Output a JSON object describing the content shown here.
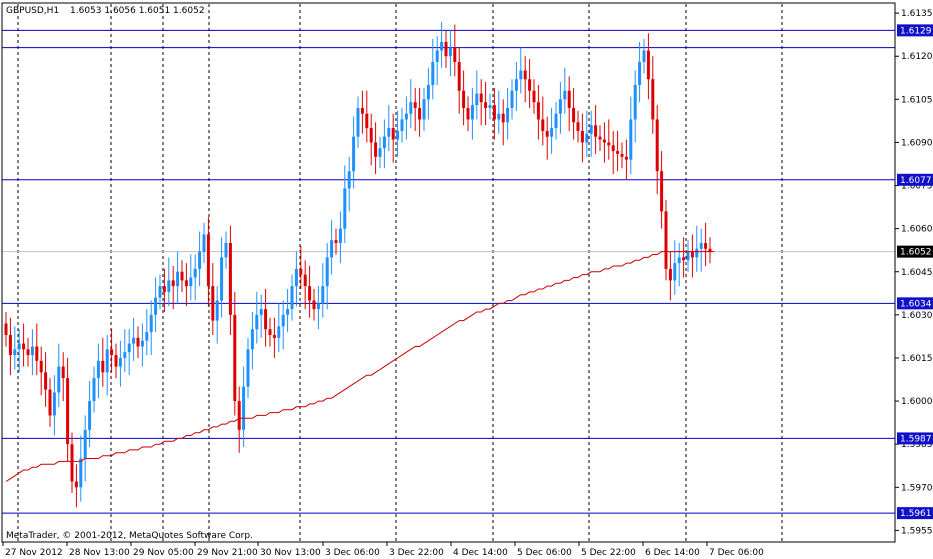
{
  "header": {
    "symbol": "GBPUSD,H1",
    "ohlc": "1.6053 1.6056 1.6051 1.6052"
  },
  "copyright": "MetaTrader, © 2001-2012, MetaQuotes Software Corp.",
  "colors": {
    "up": "#1e90ff",
    "down": "#dd0000",
    "ma": "#cc0000",
    "hline": "#0000cc",
    "grid": "#000000",
    "tag": "#1010c8",
    "current": "#000000"
  },
  "chart_data": {
    "type": "candlestick",
    "y_range": [
      1.595,
      1.614
    ],
    "y_ticks": [
      "1.6135",
      "1.6120",
      "1.6105",
      "1.6090",
      "1.6075",
      "1.6060",
      "1.6045",
      "1.6030",
      "1.6015",
      "1.6000",
      "1.5985",
      "1.5970",
      "1.5955"
    ],
    "x_ticks": [
      "27 Nov 2012",
      "28 Nov 13:00",
      "29 Nov 05:00",
      "29 Nov 21:00",
      "30 Nov 13:00",
      "3 Dec 06:00",
      "3 Dec 22:00",
      "4 Dec 14:00",
      "5 Dec 06:00",
      "5 Dec 22:00",
      "6 Dec 14:00",
      "7 Dec 06:00"
    ],
    "horizontal_lines": [
      {
        "label": "1.6129",
        "value": 1.6129
      },
      {
        "label": "1.6077",
        "value": 1.6077
      },
      {
        "label": "1.6034",
        "value": 1.6034
      },
      {
        "label": "1.5987",
        "value": 1.5987
      },
      {
        "label": "1.5961",
        "value": 1.5961
      }
    ],
    "current_price": {
      "label": "1.6052",
      "value": 1.6052
    },
    "series": [
      {
        "kind": "close",
        "values": [
          1.6023,
          1.6016,
          1.6018,
          1.602,
          1.6018,
          1.6016,
          1.6019,
          1.6014,
          1.601,
          1.6004,
          1.5995,
          1.6003,
          1.6012,
          1.6008,
          1.5985,
          1.5972,
          1.597,
          1.598,
          1.599,
          1.6,
          1.6008,
          1.6014,
          1.601,
          1.6018,
          1.6016,
          1.6012,
          1.6015,
          1.6017,
          1.602,
          1.6022,
          1.6019,
          1.6021,
          1.6024,
          1.603,
          1.6036,
          1.604,
          1.6038,
          1.6042,
          1.604,
          1.6045,
          1.6042,
          1.604,
          1.6043,
          1.6046,
          1.6052,
          1.6058,
          1.604,
          1.6028,
          1.6035,
          1.605,
          1.6055,
          1.603,
          1.6,
          1.599,
          1.6005,
          1.6018,
          1.6025,
          1.603,
          1.6032,
          1.6025,
          1.6023,
          1.6022,
          1.6026,
          1.603,
          1.6032,
          1.604,
          1.6046,
          1.6044,
          1.604,
          1.6035,
          1.6032,
          1.6034,
          1.604,
          1.605,
          1.6056,
          1.6055,
          1.606,
          1.6074,
          1.608,
          1.6092,
          1.6102,
          1.61,
          1.6095,
          1.609,
          1.6085,
          1.6088,
          1.6092,
          1.6095,
          1.6091,
          1.6094,
          1.6098,
          1.61,
          1.6104,
          1.6102,
          1.6098,
          1.6105,
          1.611,
          1.6118,
          1.6122,
          1.6125,
          1.612,
          1.6123,
          1.6118,
          1.6108,
          1.6102,
          1.6098,
          1.6103,
          1.6107,
          1.6104,
          1.6102,
          1.6103,
          1.6098,
          1.61,
          1.6097,
          1.6102,
          1.6108,
          1.6112,
          1.6115,
          1.6112,
          1.6108,
          1.6104,
          1.6098,
          1.6094,
          1.6092,
          1.6095,
          1.61,
          1.6105,
          1.6108,
          1.6102,
          1.6097,
          1.6094,
          1.609,
          1.6093,
          1.6096,
          1.6092,
          1.6091,
          1.609,
          1.6089,
          1.6087,
          1.6086,
          1.6085,
          1.6084,
          1.6098,
          1.611,
          1.6118,
          1.6122,
          1.6112,
          1.6098,
          1.608,
          1.6066,
          1.6046,
          1.6042,
          1.6048,
          1.605,
          1.6049,
          1.6052,
          1.605,
          1.6053,
          1.6055,
          1.6053,
          1.6052
        ]
      },
      {
        "kind": "moving_average",
        "values": [
          1.5972,
          1.5973,
          1.5974,
          1.5975,
          1.5976,
          1.5976,
          1.5977,
          1.5977,
          1.5978,
          1.5978,
          1.5978,
          1.5978,
          1.5979,
          1.5979,
          1.5979,
          1.5979,
          1.5979,
          1.5979,
          1.598,
          1.598,
          1.598,
          1.598,
          1.5981,
          1.5981,
          1.5981,
          1.5982,
          1.5982,
          1.5982,
          1.5983,
          1.5983,
          1.5983,
          1.5984,
          1.5984,
          1.5984,
          1.5985,
          1.5985,
          1.5986,
          1.5986,
          1.5986,
          1.5987,
          1.5987,
          1.5988,
          1.5988,
          1.5989,
          1.5989,
          1.599,
          1.599,
          1.5991,
          1.5991,
          1.5992,
          1.5992,
          1.5993,
          1.5993,
          1.5994,
          1.5994,
          1.5994,
          1.5994,
          1.5995,
          1.5995,
          1.5995,
          1.5996,
          1.5996,
          1.5996,
          1.5997,
          1.5997,
          1.5997,
          1.5998,
          1.5998,
          1.5998,
          1.5999,
          1.5999,
          1.6,
          1.6,
          1.6001,
          1.6001,
          1.6002,
          1.6003,
          1.6004,
          1.6005,
          1.6006,
          1.6007,
          1.6008,
          1.6009,
          1.6009,
          1.601,
          1.6011,
          1.6012,
          1.6013,
          1.6014,
          1.6015,
          1.6016,
          1.6017,
          1.6018,
          1.6019,
          1.6019,
          1.602,
          1.6021,
          1.6022,
          1.6023,
          1.6024,
          1.6025,
          1.6026,
          1.6027,
          1.6028,
          1.6028,
          1.6029,
          1.603,
          1.6031,
          1.6031,
          1.6032,
          1.6032,
          1.6033,
          1.6034,
          1.6034,
          1.6035,
          1.6035,
          1.6036,
          1.6037,
          1.6037,
          1.6038,
          1.6038,
          1.6039,
          1.6039,
          1.604,
          1.604,
          1.6041,
          1.6041,
          1.6042,
          1.6042,
          1.6043,
          1.6043,
          1.6044,
          1.6044,
          1.6045,
          1.6045,
          1.6045,
          1.6046,
          1.6046,
          1.6047,
          1.6047,
          1.6047,
          1.6048,
          1.6048,
          1.6049,
          1.6049,
          1.605,
          1.605,
          1.6051,
          1.6051,
          1.6052,
          1.6052,
          1.6052,
          1.6052,
          1.6052,
          1.6052,
          1.6052,
          1.6052,
          1.6052,
          1.6052,
          1.6052,
          1.6052,
          1.6052
        ]
      }
    ]
  }
}
